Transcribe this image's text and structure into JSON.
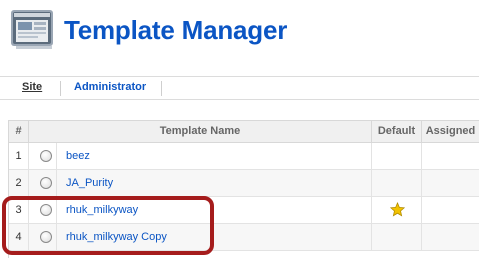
{
  "header": {
    "title": "Template Manager",
    "icon": "template-manager-icon"
  },
  "tabs": [
    {
      "label": "Site",
      "active": true
    },
    {
      "label": "Administrator",
      "active": false
    }
  ],
  "table": {
    "columns": {
      "num": "#",
      "name": "Template Name",
      "default": "Default",
      "assigned": "Assigned"
    },
    "rows": [
      {
        "num": "1",
        "name": "beez",
        "default": false
      },
      {
        "num": "2",
        "name": "JA_Purity",
        "default": false
      },
      {
        "num": "3",
        "name": "rhuk_milkyway",
        "default": true
      },
      {
        "num": "4",
        "name": "rhuk_milkyway Copy",
        "default": false
      }
    ]
  },
  "highlight": {
    "color": "#a51c1c",
    "rows": [
      "3",
      "4"
    ]
  },
  "colors": {
    "link": "#0b55c4",
    "accent": "#a51c1c",
    "star": "#f2c200"
  }
}
